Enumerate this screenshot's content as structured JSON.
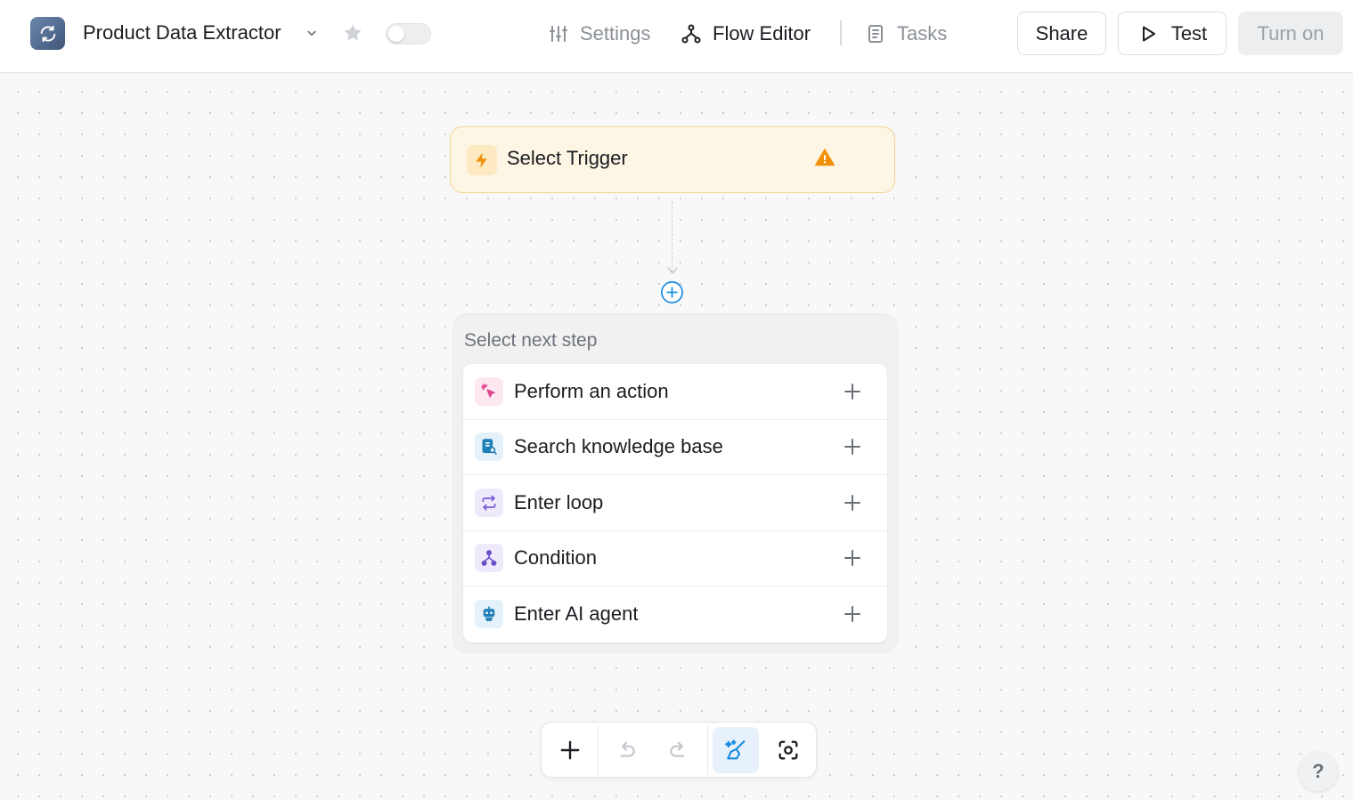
{
  "header": {
    "app_title": "Product Data Extractor",
    "nav": {
      "settings": "Settings",
      "flow_editor": "Flow Editor",
      "tasks": "Tasks"
    },
    "buttons": {
      "share": "Share",
      "test": "Test",
      "turn_on": "Turn on"
    },
    "toggle_enabled": false,
    "active_tab": "Flow Editor"
  },
  "canvas": {
    "trigger": {
      "label": "Select Trigger",
      "status": "warning"
    },
    "next_step": {
      "heading": "Select next step",
      "options": [
        {
          "label": "Perform an action",
          "icon": "cursor-click-icon",
          "color": "#e0468e"
        },
        {
          "label": "Search knowledge base",
          "icon": "knowledge-base-icon",
          "color": "#1f7fb6"
        },
        {
          "label": "Enter loop",
          "icon": "loop-icon",
          "color": "#7a5bd6"
        },
        {
          "label": "Condition",
          "icon": "branch-icon",
          "color": "#6b4fc9"
        },
        {
          "label": "Enter AI agent",
          "icon": "robot-icon",
          "color": "#1f7fb6"
        }
      ]
    }
  },
  "toolbar": {
    "items": [
      "add-icon",
      "undo-icon",
      "redo-icon",
      "auto-layout-icon",
      "focus-icon"
    ],
    "active": "auto-layout-icon"
  },
  "help": {
    "label": "?"
  },
  "colors": {
    "accent": "#1a8ce0",
    "warning": "#f0900a",
    "trigger_bg": "#fef6e5",
    "trigger_border": "#f3d592"
  }
}
